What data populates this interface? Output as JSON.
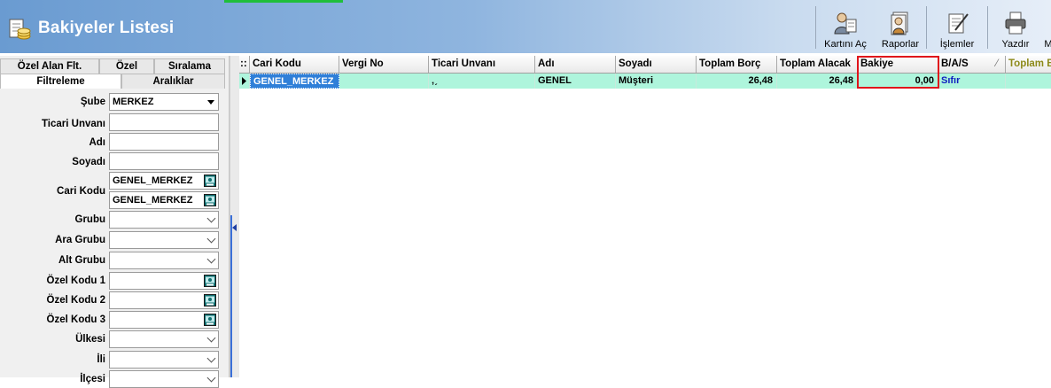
{
  "window": {
    "title": "Bakiyeler Listesi"
  },
  "toolbar": {
    "buttons": [
      {
        "label": "Kartını Aç",
        "icon": "open-card-icon"
      },
      {
        "label": "Raporlar",
        "icon": "reports-icon"
      },
      {
        "label": "İşlemler",
        "icon": "operations-icon"
      },
      {
        "label": "Yazdır",
        "icon": "printer-icon"
      },
      {
        "label": "M",
        "icon": "more-icon"
      }
    ]
  },
  "filter_panel": {
    "tabs_row1": [
      "Özel Alan Flt.",
      "Özel",
      "Sıralama"
    ],
    "tabs_row2": [
      "Filtreleme",
      "Aralıklar"
    ],
    "active_tab": "Filtreleme",
    "fields": {
      "sube": {
        "label": "Şube",
        "value": "MERKEZ"
      },
      "ticari_unvani": {
        "label": "Ticari Unvanı",
        "value": ""
      },
      "adi": {
        "label": "Adı",
        "value": ""
      },
      "soyadi": {
        "label": "Soyadı",
        "value": ""
      },
      "cari_kodu": {
        "label": "Cari Kodu",
        "value_from": "GENEL_MERKEZ",
        "value_to": "GENEL_MERKEZ"
      },
      "grubu": {
        "label": "Grubu",
        "value": ""
      },
      "ara_grubu": {
        "label": "Ara Grubu",
        "value": ""
      },
      "alt_grubu": {
        "label": "Alt Grubu",
        "value": ""
      },
      "ozel_kodu_1": {
        "label": "Özel Kodu 1",
        "value": ""
      },
      "ozel_kodu_2": {
        "label": "Özel Kodu 2",
        "value": ""
      },
      "ozel_kodu_3": {
        "label": "Özel Kodu 3",
        "value": ""
      },
      "ulkesi": {
        "label": "Ülkesi",
        "value": ""
      },
      "ili": {
        "label": "İli",
        "value": ""
      },
      "ilcesi": {
        "label": "İlçesi",
        "value": ""
      }
    }
  },
  "grid": {
    "header_marker": "::",
    "columns": [
      "Cari Kodu",
      "Vergi No",
      "Ticari Unvanı",
      "Adı",
      "Soyadı",
      "Toplam Borç",
      "Toplam Alacak",
      "Bakiye",
      "B/A/S",
      "Toplam B"
    ],
    "rows": [
      {
        "cari_kodu": "GENEL_MERKEZ",
        "vergi_no": "",
        "ticari_unvani": "‚ˏ",
        "adi": "GENEL",
        "soyadi": "Müşteri",
        "toplam_borc": "26,48",
        "toplam_alacak": "26,48",
        "bakiye": "0,00",
        "bas": "Sıfır",
        "toplam_b": ""
      }
    ]
  },
  "colors": {
    "header_start": "#6a9bd1",
    "row_selected": "#aef5dc",
    "highlight_box": "#e0141b",
    "status_text": "#1020c0"
  }
}
